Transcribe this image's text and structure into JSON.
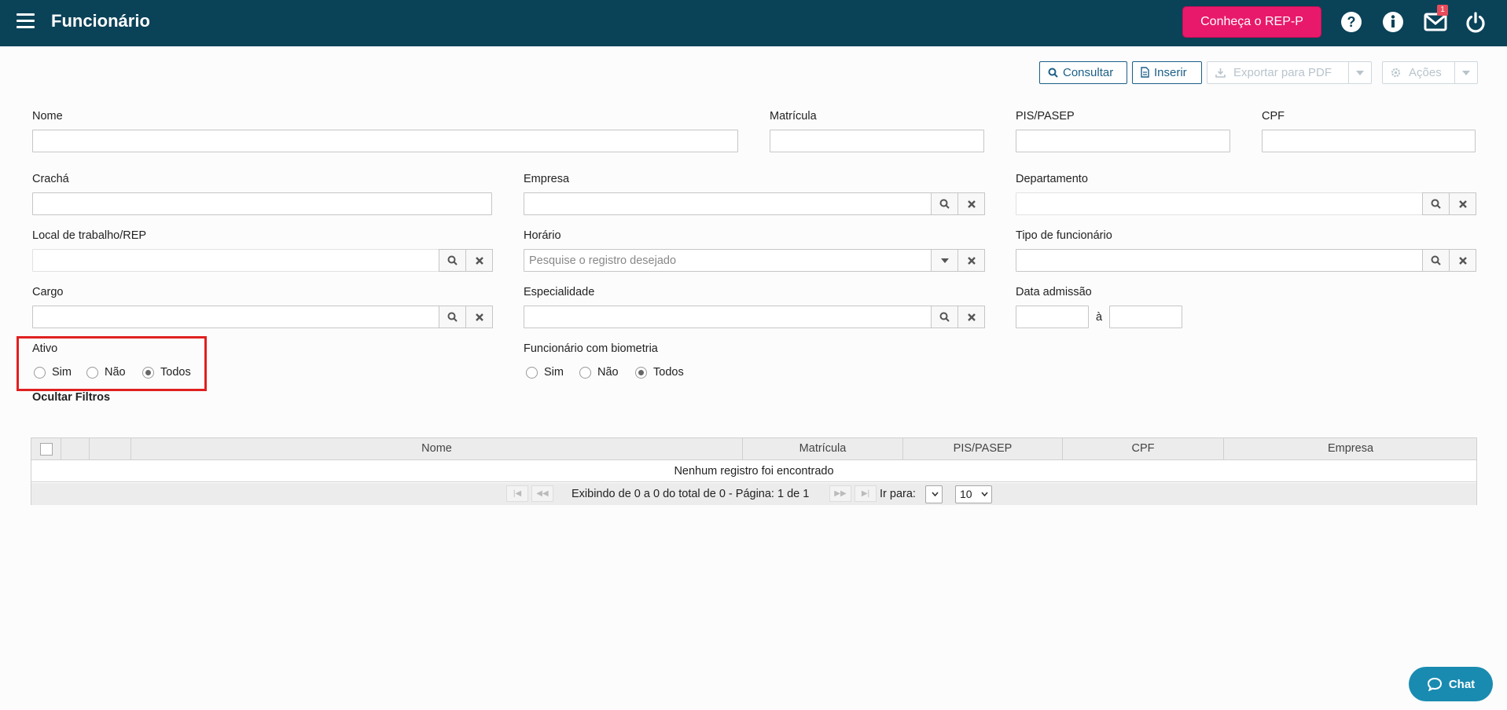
{
  "app": {
    "title": "Funcionário"
  },
  "header": {
    "rep_button": "Conheça o REP-P",
    "mail_badge": "1",
    "icons": [
      "menu-icon",
      "help-icon",
      "info-icon",
      "mail-icon",
      "power-icon"
    ]
  },
  "toolbar": {
    "consultar": "Consultar",
    "inserir": "Inserir",
    "exportar": "Exportar para PDF",
    "acoes": "Ações"
  },
  "form": {
    "nome": "Nome",
    "matricula": "Matrícula",
    "pis": "PIS/PASEP",
    "cpf": "CPF",
    "cracha": "Crachá",
    "empresa": "Empresa",
    "departamento": "Departamento",
    "local": "Local de trabalho/REP",
    "horario": "Horário",
    "horario_placeholder": "Pesquise o registro desejado",
    "tipo": "Tipo de funcionário",
    "cargo": "Cargo",
    "especialidade": "Especialidade",
    "data_admissao": "Data admissão",
    "date_sep": "à",
    "ativo": {
      "label": "Ativo",
      "options": [
        "Sim",
        "Não",
        "Todos"
      ],
      "selected": "Todos"
    },
    "biometria": {
      "label": "Funcionário com biometria",
      "options": [
        "Sim",
        "Não",
        "Todos"
      ],
      "selected": "Todos"
    },
    "hide_filters": "Ocultar Filtros"
  },
  "table": {
    "columns": [
      "Nome",
      "Matrícula",
      "PIS/PASEP",
      "CPF",
      "Empresa"
    ],
    "empty_message": "Nenhum registro foi encontrado",
    "pager_text": "Exibindo de 0 a 0 do total de 0 - Página: 1 de 1",
    "goto_label": "Ir para:",
    "goto_value": "",
    "page_size": "10"
  },
  "chat": {
    "label": "Chat"
  },
  "colors": {
    "header_bg": "#0a4258",
    "accent_pink": "#e8196b",
    "button_border": "#1b5f86",
    "highlight_red": "#e02020",
    "chat_bg": "#1a8bb0"
  }
}
